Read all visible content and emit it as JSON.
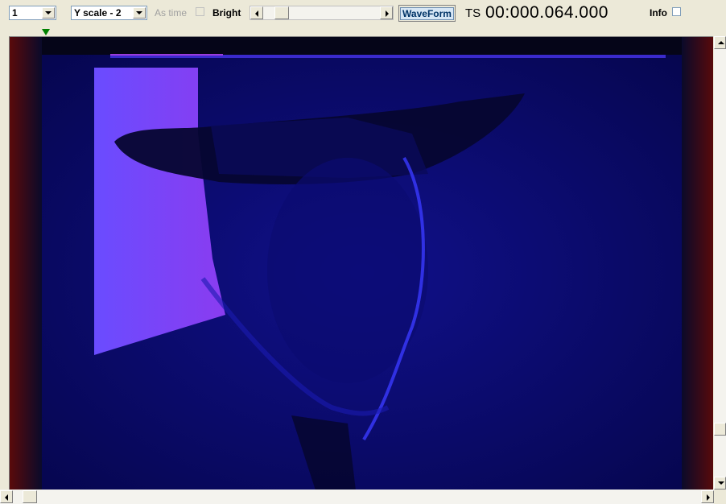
{
  "toolbar": {
    "channel_select": "1",
    "yscale_select": "Y scale - 2",
    "as_time_label": "As time",
    "bright_label": "Bright",
    "waveform_button": "WaveForm",
    "ts_label": "TS",
    "ts_value": "00:000.064.000",
    "info_label": "Info"
  },
  "controls": {
    "as_time_checked": false,
    "info_checked": false
  },
  "viewport": {
    "content": "blue-tinted video frame of a person wearing a wide-brimmed hat",
    "colors": {
      "background": "#0a0a3a",
      "blue": "#1a1acc",
      "violet": "#7a3cff",
      "border_red": "#5a0a0a"
    }
  },
  "icons": [
    "dropdown-arrow-icon",
    "scroll-left-icon",
    "scroll-right-icon",
    "scroll-up-icon",
    "scroll-down-icon",
    "position-marker-icon"
  ]
}
